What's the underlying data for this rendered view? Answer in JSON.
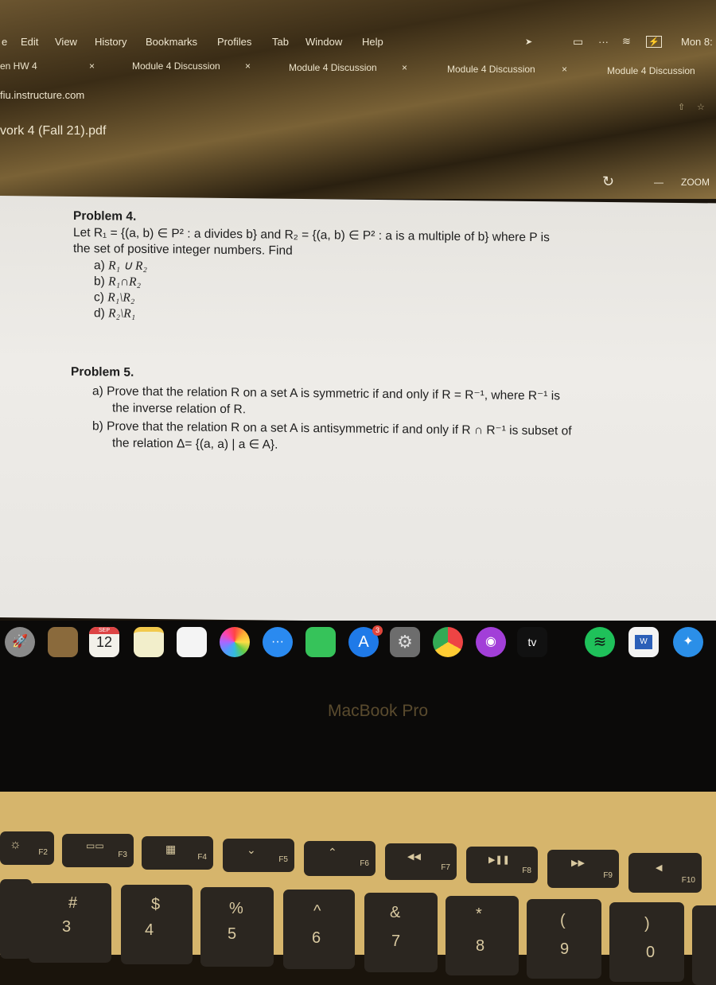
{
  "menubar": {
    "items": [
      "e",
      "Edit",
      "View",
      "History",
      "Bookmarks",
      "Profiles",
      "Tab",
      "Window",
      "Help"
    ],
    "clock": "Mon 8:"
  },
  "tabs": [
    {
      "label": "en HW 4",
      "close": "×"
    },
    {
      "label": "Module 4 Discussion",
      "close": "×"
    },
    {
      "label": "Module 4 Discussion",
      "close": "×"
    },
    {
      "label": "Module 4 Discussion",
      "close": "×"
    },
    {
      "label": "Module 4 Discussion",
      "close": ""
    }
  ],
  "address": {
    "url": "fiu.instructure.com"
  },
  "pdf": {
    "filename": "vork 4 (Fall 21).pdf",
    "zoom_label": "ZOOM",
    "zoom_minus": "—"
  },
  "document": {
    "problem4": {
      "title": "Problem 4.",
      "line1": "Let R₁ = {(a, b) ∈ P² : a divides b} and R₂ = {(a, b) ∈ P² : a is a multiple of b} where P is",
      "line2": "the set of positive integer numbers. Find",
      "parts": [
        {
          "label": "a)",
          "expr": "R₁ ∪ R₂"
        },
        {
          "label": "b)",
          "expr": "R₁∩R₂"
        },
        {
          "label": "c)",
          "expr": "R₁\\R₂"
        },
        {
          "label": "d)",
          "expr": "R₂\\R₁"
        }
      ]
    },
    "problem5": {
      "title": "Problem 5.",
      "parts": [
        {
          "label": "a)",
          "line1": "Prove that the relation R on a set A is symmetric if and only if R = R⁻¹, where R⁻¹ is",
          "line2": "the inverse relation of R."
        },
        {
          "label": "b)",
          "line1": "Prove that the relation R on a set A is antisymmetric if and only if R ∩ R⁻¹ is subset of",
          "line2": "the relation Δ= {(a, a) | a ∈ A}."
        }
      ]
    }
  },
  "dock": {
    "apps": [
      "launchpad-icon",
      "folder-icon",
      "calendar-icon",
      "notes-icon",
      "reminders-icon",
      "photos-icon",
      "messages-icon",
      "facetime-icon",
      "app-store-icon",
      "system-preferences-icon",
      "chrome-icon",
      "podcasts-icon",
      "apple-tv-icon",
      "spotify-icon",
      "word-icon",
      "safari-icon"
    ],
    "calendar_month": "SEP",
    "calendar_day": "12",
    "app_store_badge": "3",
    "tv_label": "tv"
  },
  "bezel": {
    "label": "MacBook Pro"
  },
  "keyboard": {
    "fn_keys": [
      {
        "glyph": "☼",
        "label": "F2"
      },
      {
        "glyph": "▭▭",
        "label": "F3"
      },
      {
        "glyph": "▦",
        "label": "F4"
      },
      {
        "glyph": "⌄",
        "label": "F5"
      },
      {
        "glyph": "⌃",
        "label": "F6"
      },
      {
        "glyph": "◀◀",
        "label": "F7"
      },
      {
        "glyph": "▶❚❚",
        "label": "F8"
      },
      {
        "glyph": "▶▶",
        "label": "F9"
      },
      {
        "glyph": "◀",
        "label": "F10"
      }
    ],
    "number_keys": [
      {
        "top": "#",
        "bottom": "3"
      },
      {
        "top": "$",
        "bottom": "4"
      },
      {
        "top": "%",
        "bottom": "5"
      },
      {
        "top": "^",
        "bottom": "6"
      },
      {
        "top": "&",
        "bottom": "7"
      },
      {
        "top": "*",
        "bottom": "8"
      },
      {
        "top": "(",
        "bottom": "9"
      },
      {
        "top": ")",
        "bottom": "0"
      }
    ]
  }
}
